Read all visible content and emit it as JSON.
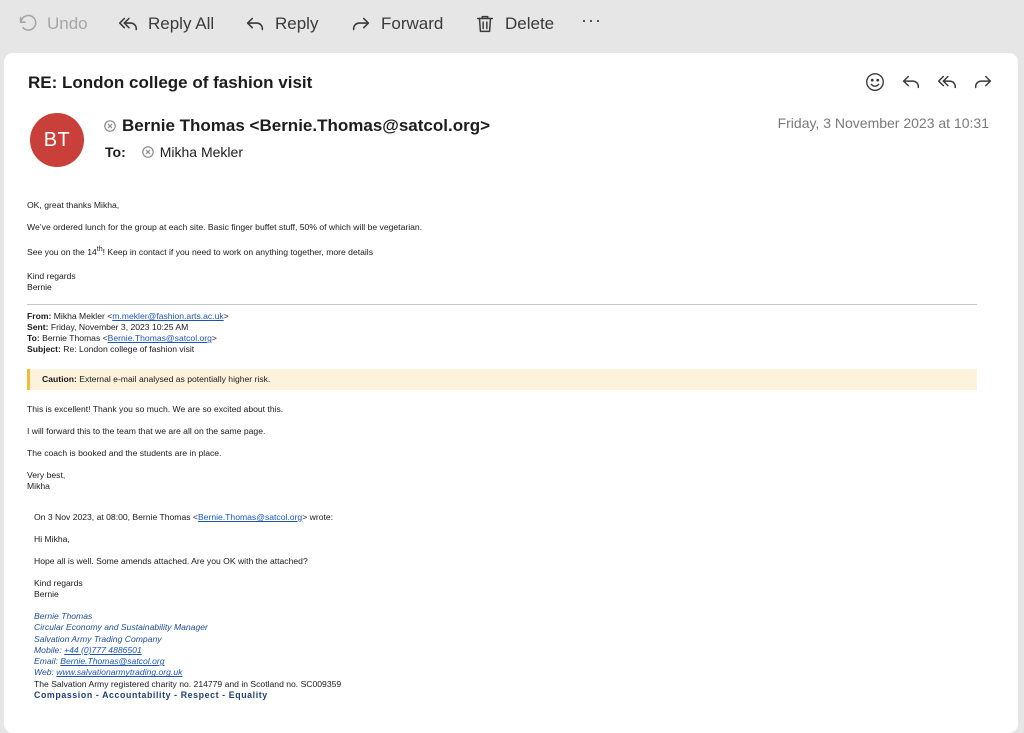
{
  "toolbar": {
    "undo": "Undo",
    "reply_all": "Reply All",
    "reply": "Reply",
    "forward": "Forward",
    "delete": "Delete",
    "more": "···"
  },
  "message": {
    "subject": "RE: London college of fashion visit",
    "avatar_initials": "BT",
    "avatar_color": "#c9403a",
    "from": "Bernie Thomas <Bernie.Thomas@satcol.org>",
    "to_label": "To:",
    "to": "Mikha Mekler",
    "date": "Friday, 3 November 2023 at 10:31"
  },
  "body": {
    "p1": "OK, great thanks Mikha,",
    "p2": "We’ve ordered lunch for the group at each site. Basic finger buffet stuff, 50% of which will be vegetarian.",
    "p3_pre": "See you on the 14",
    "p3_sup": "th",
    "p3_post": "!  Keep in contact if you need to work on anything together, more details",
    "regards": "Kind regards",
    "name": "Bernie"
  },
  "forwarded": {
    "from_label": "From:",
    "from_name": "Mikha Mekler <",
    "from_email": "m.mekler@fashion.arts.ac.uk",
    "from_end": ">",
    "sent_label": "Sent:",
    "sent": "Friday, November 3, 2023 10:25 AM",
    "to_label": "To:",
    "to_name": "Bernie Thomas <",
    "to_email": "Bernie.Thomas@satcol.org",
    "to_end": ">",
    "subject_label": "Subject:",
    "subject": "Re: London college of fashion visit",
    "caution_label": "Caution:",
    "caution_text": "External e-mail analysed as potentially higher risk.",
    "p1": "This is excellent! Thank you so much. We are so excited about this.",
    "p2": "I will forward this to the team that we are all on the same page.",
    "p3": "The coach is booked and the students are in place.",
    "signoff": "Very best,",
    "signname": "Mikha"
  },
  "quoted": {
    "header_pre": "On 3 Nov 2023, at 08:00, Bernie Thomas <",
    "header_email": "Bernie.Thomas@satcol.org",
    "header_post": "> wrote:",
    "greeting": "Hi Mikha,",
    "p1": "Hope all is well. Some amends attached. Are you OK with the attached?",
    "regards": "Kind regards",
    "name": "Bernie"
  },
  "signature": {
    "name": "Bernie Thomas",
    "title": "Circular Economy and Sustainability Manager",
    "company": "Salvation Army Trading Company",
    "mobile_label": "Mobile: ",
    "mobile": "+44 (0)777 4886501",
    "email_label": "Email: ",
    "email": "Bernie.Thomas@satcol.org",
    "web_label": "Web:  ",
    "web": "www.salvationarmytrading.org.uk",
    "charity": "The Salvation Army registered charity no. 214779 and in Scotland no. SC009359",
    "motto": "Compassion - Accountability - Respect - Equality"
  }
}
